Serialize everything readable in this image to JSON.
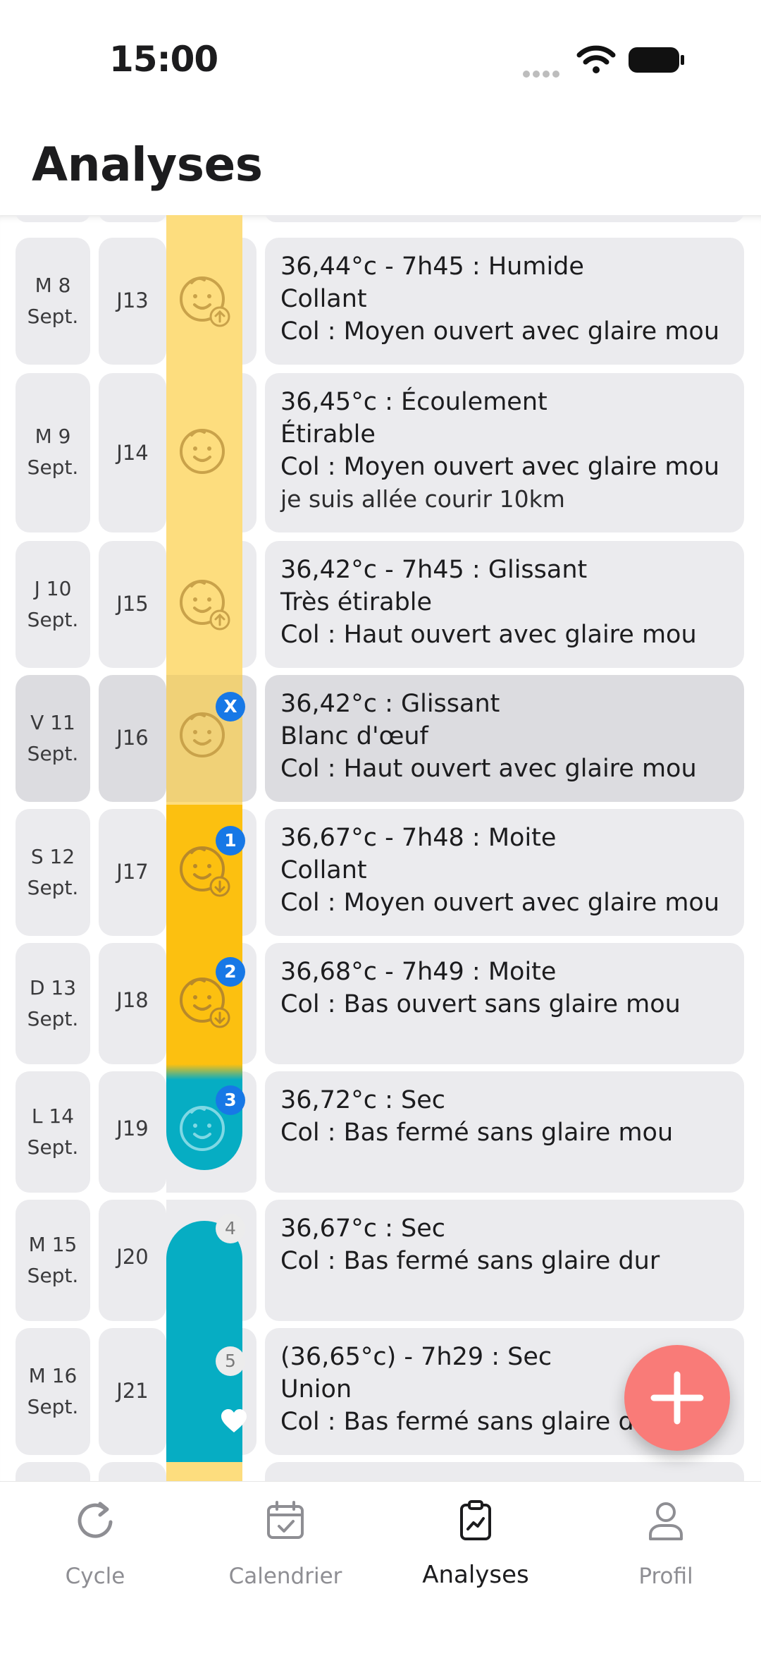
{
  "status": {
    "time": "15:00"
  },
  "header": {
    "title": "Analyses"
  },
  "rows": [
    {
      "date_line1": "M 8",
      "date_line2": "Sept.",
      "day": "J13",
      "lines": [
        "36,44°c - 7h45 : Humide",
        "Collant",
        "Col : Moyen ouvert avec glaire mou"
      ],
      "sub": ""
    },
    {
      "date_line1": "M 9",
      "date_line2": "Sept.",
      "day": "J14",
      "lines": [
        "36,45°c : Écoulement",
        "Étirable",
        "Col : Moyen ouvert avec glaire mou"
      ],
      "sub": "je suis allée courir 10km"
    },
    {
      "date_line1": "J 10",
      "date_line2": "Sept.",
      "day": "J15",
      "lines": [
        "36,42°c - 7h45 : Glissant",
        "Très étirable",
        "Col : Haut ouvert avec glaire mou"
      ],
      "sub": ""
    },
    {
      "date_line1": "V 11",
      "date_line2": "Sept.",
      "day": "J16",
      "lines": [
        "36,42°c : Glissant",
        "Blanc d'œuf",
        "Col : Haut ouvert avec glaire mou"
      ],
      "sub": "",
      "badge": "X"
    },
    {
      "date_line1": "S 12",
      "date_line2": "Sept.",
      "day": "J17",
      "lines": [
        "36,67°c - 7h48 : Moite",
        "Collant",
        "Col : Moyen ouvert avec glaire mou"
      ],
      "sub": "",
      "badge": "1"
    },
    {
      "date_line1": "D 13",
      "date_line2": "Sept.",
      "day": "J18",
      "lines": [
        "36,68°c - 7h49 : Moite",
        "Col : Bas ouvert sans glaire mou",
        ""
      ],
      "sub": "",
      "badge": "2"
    },
    {
      "date_line1": "L 14",
      "date_line2": "Sept.",
      "day": "J19",
      "lines": [
        "36,72°c : Sec",
        "Col : Bas fermé sans glaire mou",
        ""
      ],
      "sub": "",
      "badge": "3"
    },
    {
      "date_line1": "M 15",
      "date_line2": "Sept.",
      "day": "J20",
      "lines": [
        "36,67°c : Sec",
        "Col : Bas fermé sans glaire dur",
        ""
      ],
      "sub": "",
      "badge": "4"
    },
    {
      "date_line1": "M 16",
      "date_line2": "Sept.",
      "day": "J21",
      "lines": [
        "(36,65°c) - 7h29 : Sec",
        "Union",
        "Col : Bas fermé sans glaire du"
      ],
      "sub": "",
      "badge": "5"
    }
  ],
  "colors": {
    "fertile_light": "#fddd7e",
    "fertile_peak": "#fcc010",
    "infertile": "#06adc3",
    "badge": "#1778e6",
    "fab": "#f97b78"
  },
  "icons": {
    "fertility_face": "baby-face-icon",
    "heart": "heart-icon",
    "add": "plus-icon"
  },
  "tabbar": {
    "tabs": [
      {
        "label": "Cycle",
        "icon": "refresh-icon"
      },
      {
        "label": "Calendrier",
        "icon": "calendar-check-icon"
      },
      {
        "label": "Analyses",
        "icon": "clipboard-chart-icon",
        "active": true
      },
      {
        "label": "Profil",
        "icon": "user-icon"
      }
    ]
  }
}
